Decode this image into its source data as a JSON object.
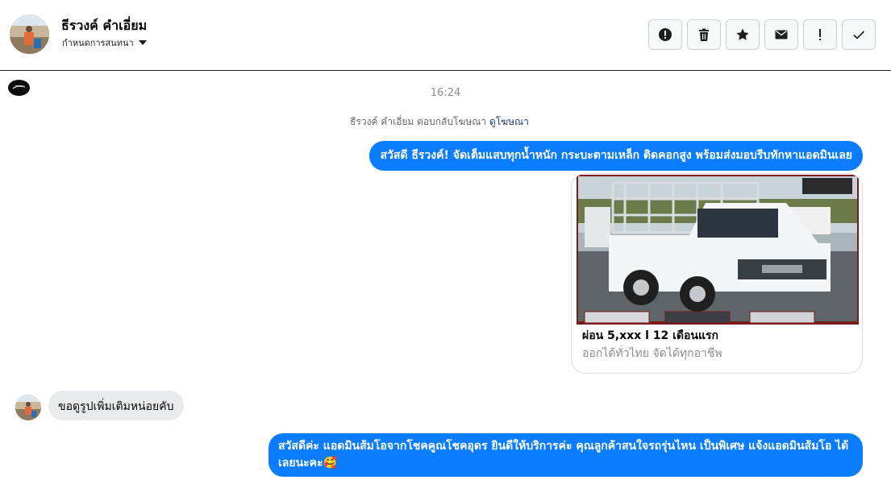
{
  "header": {
    "contact_name": "ธีรวงค์ คำเอี่ยม",
    "assign_label": "กำหนดการสนทนา"
  },
  "actions": [
    {
      "icon": "alert-circle-icon"
    },
    {
      "icon": "trash-icon"
    },
    {
      "icon": "star-icon"
    },
    {
      "icon": "envelope-icon"
    },
    {
      "icon": "exclamation-icon"
    },
    {
      "icon": "check-icon"
    }
  ],
  "thread": {
    "timestamp": "16:24",
    "reply_note": "ธีรวงค์ คำเอี่ยม ตอบกลับโฆษณา",
    "reply_link": "ดูโฆษณา",
    "messages": {
      "out_1": "สวัสดี ธีรวงค์! จัดเต็มแสบทุกน้ำหนัก กระบะตามเหล็ก ติดคอกสูง พร้อมส่งมอบรีบทักหาแอดมินเลย",
      "card_title": "ผ่อน 5,xxx l 12 เดือนแรก",
      "card_subtitle": "ออกได้ทั่วไทย จัดได้ทุกอาชีพ",
      "in_1": "ขอดูรูปเพิ่มเติมหน่อยคับ",
      "out_2": "สวัสดีค่ะ แอดมินส้มโอจากโชคคูณโชคอุดร ยินดีให้บริการค่ะ คุณลูกค้าสนใจรถรุ่นไหน เป็นพิเศษ แจ้งแอดมินส้มโอ ได้เลยนะคะ🥰"
    }
  },
  "colors": {
    "accent": "#0a7cff",
    "incoming_bubble": "#e9ebee",
    "muted_text": "#8a8d91"
  }
}
